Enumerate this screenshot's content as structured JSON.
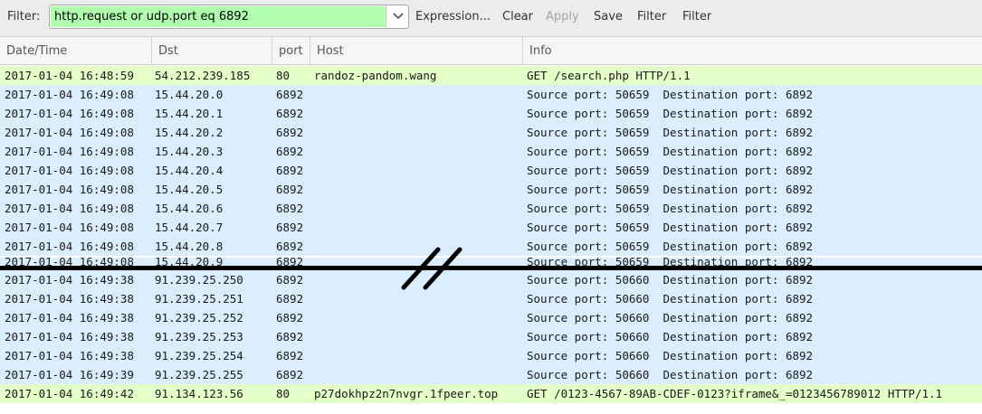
{
  "toolbar": {
    "filter_label": "Filter:",
    "filter_value": "http.request or udp.port eq 6892",
    "filter_status_color": "#afffaf",
    "buttons": {
      "expression": "Expression...",
      "clear": "Clear",
      "apply": "Apply",
      "save": "Save",
      "filter1": "Filter",
      "filter2": "Filter"
    }
  },
  "columns": {
    "time": "Date/Time",
    "dst": "Dst",
    "port": "port",
    "host": "Host",
    "info": "Info"
  },
  "colors": {
    "http_row": "#e4ffc7",
    "udp_row": "#daeeff"
  },
  "break_marker_icon": "double-slash-break-icon",
  "rows_top": [
    {
      "type": "http",
      "time": "2017-01-04 16:48:59",
      "dst": "54.212.239.185",
      "port": "80",
      "host": "randoz-pandom.wang",
      "info": "GET /search.php HTTP/1.1"
    },
    {
      "type": "udp",
      "time": "2017-01-04 16:49:08",
      "dst": "15.44.20.0",
      "port": "6892",
      "host": "",
      "info": "Source port: 50659  Destination port: 6892"
    },
    {
      "type": "udp",
      "time": "2017-01-04 16:49:08",
      "dst": "15.44.20.1",
      "port": "6892",
      "host": "",
      "info": "Source port: 50659  Destination port: 6892"
    },
    {
      "type": "udp",
      "time": "2017-01-04 16:49:08",
      "dst": "15.44.20.2",
      "port": "6892",
      "host": "",
      "info": "Source port: 50659  Destination port: 6892"
    },
    {
      "type": "udp",
      "time": "2017-01-04 16:49:08",
      "dst": "15.44.20.3",
      "port": "6892",
      "host": "",
      "info": "Source port: 50659  Destination port: 6892"
    },
    {
      "type": "udp",
      "time": "2017-01-04 16:49:08",
      "dst": "15.44.20.4",
      "port": "6892",
      "host": "",
      "info": "Source port: 50659  Destination port: 6892"
    },
    {
      "type": "udp",
      "time": "2017-01-04 16:49:08",
      "dst": "15.44.20.5",
      "port": "6892",
      "host": "",
      "info": "Source port: 50659  Destination port: 6892"
    },
    {
      "type": "udp",
      "time": "2017-01-04 16:49:08",
      "dst": "15.44.20.6",
      "port": "6892",
      "host": "",
      "info": "Source port: 50659  Destination port: 6892"
    },
    {
      "type": "udp",
      "time": "2017-01-04 16:49:08",
      "dst": "15.44.20.7",
      "port": "6892",
      "host": "",
      "info": "Source port: 50659  Destination port: 6892"
    },
    {
      "type": "udp",
      "time": "2017-01-04 16:49:08",
      "dst": "15.44.20.8",
      "port": "6892",
      "host": "",
      "info": "Source port: 50659  Destination port: 6892"
    }
  ],
  "row_cut": {
    "type": "udp",
    "time": "2017-01-04 16:49:08",
    "dst": "15.44.20.9",
    "port": "6892",
    "host": "",
    "info": "Source port: 50659  Destination port: 6892"
  },
  "rows_bottom": [
    {
      "type": "udp",
      "time": "2017-01-04 16:49:38",
      "dst": "91.239.25.250",
      "port": "6892",
      "host": "",
      "info": "Source port: 50660  Destination port: 6892"
    },
    {
      "type": "udp",
      "time": "2017-01-04 16:49:38",
      "dst": "91.239.25.251",
      "port": "6892",
      "host": "",
      "info": "Source port: 50660  Destination port: 6892"
    },
    {
      "type": "udp",
      "time": "2017-01-04 16:49:38",
      "dst": "91.239.25.252",
      "port": "6892",
      "host": "",
      "info": "Source port: 50660  Destination port: 6892"
    },
    {
      "type": "udp",
      "time": "2017-01-04 16:49:38",
      "dst": "91.239.25.253",
      "port": "6892",
      "host": "",
      "info": "Source port: 50660  Destination port: 6892"
    },
    {
      "type": "udp",
      "time": "2017-01-04 16:49:38",
      "dst": "91.239.25.254",
      "port": "6892",
      "host": "",
      "info": "Source port: 50660  Destination port: 6892"
    },
    {
      "type": "udp",
      "time": "2017-01-04 16:49:39",
      "dst": "91.239.25.255",
      "port": "6892",
      "host": "",
      "info": "Source port: 50660  Destination port: 6892"
    },
    {
      "type": "http",
      "time": "2017-01-04 16:49:42",
      "dst": "91.134.123.56",
      "port": "80",
      "host": "p27dokhpz2n7nvgr.1fpeer.top",
      "info": "GET /0123-4567-89AB-CDEF-0123?iframe&_=0123456789012 HTTP/1.1"
    }
  ]
}
